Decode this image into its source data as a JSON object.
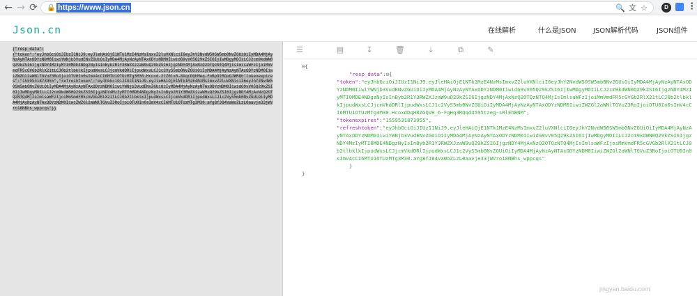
{
  "browser": {
    "nav": {
      "back": "←",
      "forward": "→",
      "reload": "⟳"
    },
    "url": "https://www.json.cn",
    "lock": "🔒",
    "icons": {
      "zoom": "🔍",
      "translate": "文",
      "star": "☆",
      "profile": "D",
      "menu": "⋮"
    }
  },
  "site": {
    "logo": "Json.cn",
    "nav": [
      "在线解析",
      "什么是JSON",
      "JSON解析代码",
      "JSON组件"
    ]
  },
  "input_text": {
    "plain": "{\"resp_data\":\n{\"token\":\"eyJhbGciOiJIUzI1NiJ9.eyJleHAiOjE1NTk1MzE4NzMsImxvZ2luVXNlciI6eyJhY2NvdW50SW5mb0NvZGUiOiIyMDA4MjAyNzAyNTAxODYzNDM0IiwiYWNjb3VudENvZGUiOiIyMDA4MjAyNzAyNTAxODYzNDM0IiwidG9vV05Q29kZSI6IjIwMDgyMDIiLCJ2cm9kdWN0Q29kZSI6IjgzNDY4MzIyMTI0MDE4NDgzNyIsInByb2R1Y3RWZXJzaW9uQ29kZSI6IjgzNDY4MjAxNzQ2OTQzNTQ4MjIsImlsaWFzIjoiMmVmdFR5cGVGb2RlX21tLCJ0b2tlbklkIjpudWxsLCJjcmVkdDRlIjpudWxsLCJ1c2VyS5mb0NvZGUiOiIyMDA4MjAyNzAyNTAxODYzNDM0IiwiZWZGl2aWNlTGVuZ3RoIjoiOTU0In0sImV4cCI6MTU1OTUzMTg3M30.Hcoxd-2tZ0lx0-8XqcDQhMeq-FoBp9tRQuQJWRQh",
    "sel_part": "\"tokenexpires\":\"1559531873955\",\"refreshtoken\":\"eyJhbGciOiJIUzI1NiJ9.eyJleHAiOjE1NTk1MzE4NzMsImxvZ2luVXNlciI6eyJhY2NvdW50SW5mb0NvZGUiOiIyMDA4MjAyNzAyNTAxODYzNDM0IiwiYWNjb3VudENvZGUiOiIyMDA4MjAyNzAyNTAxODYzNDM0IiwidG9vV05Q29kZSI6IjIwMDgyMDIiLCJ2cm9kdWN0Q29kZSI6IjgzNDY4MzIyMTI0MDE4NDgzNyIsInByb2R1Y3RWZXJzaW9uQ29kZSI6IjgzNDY4MjAxNzQ2OTQzNTQ4MjIsImlsaWFzIjoiMmVmdFR5cGVGb2RlX21tLCJ0b2tlbklkIjpudWxsLCJjcmVkdDRlIjpudWxsLCJ1c2VyS5mb0NvZGUiOiIyMDA4MjAyNzAyNTAxODYzNDM0IiwiZWZGl2aWNlTGVuZ3RoIjoiOTU0In0sImV4cCI6MTU1OTUzMTg3M30.aYg8fJ84VaWoZLzL0aavje33jWVro18NBhs_wppcqs\"}}"
  },
  "toolbar": {
    "icons": [
      "format-icon",
      "file-icon",
      "sort-icon",
      "delete-icon",
      "download-icon",
      "copy-icon",
      "clean-icon"
    ],
    "glyphs": [
      "☰",
      "▤",
      "↧",
      "🗑",
      "⤓",
      "⧉",
      "✎"
    ]
  },
  "json_view": {
    "open_brace": "{",
    "root_collapse": "⊟",
    "resp_key": "\"resp_data\"",
    "resp_collapse": ":⊟{",
    "token_key": "\"token\"",
    "token_value": "\"eyJhbGciOiJIUzI1NiJ9.eyJleHAiOjE1NTk1MzE4NzMsImxvZ2luVXNlciI6eyJhY2NvdW50SW5mb0NvZGUiOiIyMDA4MjAyNzAyNTAxODYzNDM0IiwiYWNjb3VudENvZGUiOiIyMDA4MjAyNzAyNTAxODYzNDM0IiwidG9vV05Q29kZSI6IjIwMDgyMDIiLCJ2cm9kdWN0Q29kZSI6IjgzNDY4MzIyMTI0MDE4NDgzNyIsInByb2R1Y3RWZXJzaW9uQ29kZSI6IjgzNDY4MjAxNzQ2OTQzNTQ4MjIsImlsaWFzIjoiMmVmdFR5cGVGb2RlX21tLCJ0b2tlbklkIjpudWxsLCJjcmVkdDRlIjpudWxsLCJ1c2VyS5mb0NvZGUiOiIyMDA4MjAyNzAyNTAxODYzNDM0IiwiZWZGl2aWNlTGVuZ3RoIjoiOTU0In0sImV4cCI6MTU1OTUzMTg3M30.HcoxdDqH8ZGQVH_6-FgHq3RQqd4595tzeg-sRlEhBNM\"",
    "tokenexpires_key": "\"tokenexpires\"",
    "tokenexpires_value": "\"1559531873955\"",
    "refreshtoken_key": "\"refreshtoken\"",
    "refreshtoken_value": "\"eyJhbGciOiJIUzI1NiJ9.eyJleHAiOjE1NTk1MzE4NzMsImxvZ2luVXNlciI6eyJhY2NvdW50SW5mb0NvZGUiOiIyMDA4MjAyNzAyNTAxODYzNDM0IiwiYWNjb3VudENvZGUiOiIyMDA4MjAyNzAyNTAxODYzNDM0IiwidG9vV05Q29kZSI6IjIwMDgyMDIiLCJ2cm9kdWN0Q29kZSI6IjgzNDY4MzIyMTI0MDE4NDgzNyIsInByb2R1Y3RWZXJzaW9uQ29kZSI6IjgzNDY4MjAxNzQ2OTQzNTQ4MjIsImlsaWFzIjoiMmVmdFR5cGVGb2RlX21tLCJ0b2tlbklkIjpudWxsLCJjcmVkdDRlIjpudWxsLCJ1c2VyS5mb0NvZGUiOiIyMDA4MjAyNzAyNTAxODYzNDM0IiwiZWZGl2aWNlTGVuZ3RoIjoiOTU0In0sImV4cCI6MTU1OTUzMTg3M30.aYg8fJ84VaWoZLzL0aavje33jWVro18NBhs_wppcqs\"",
    "inner_close": "}",
    "outer_close": "}",
    "colon": ":",
    "comma": ","
  },
  "watermark": "jingyan.baidu.com"
}
